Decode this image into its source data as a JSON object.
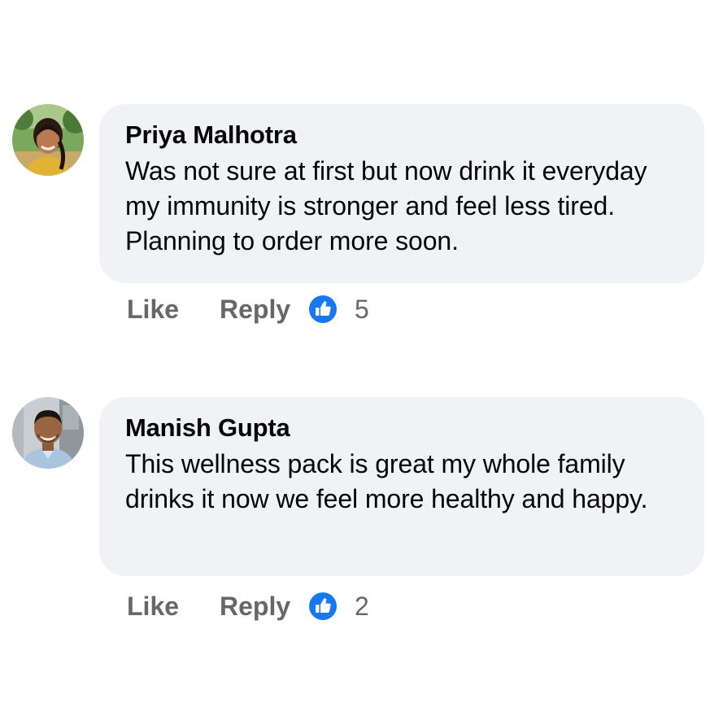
{
  "comments": [
    {
      "author": "Priya Malhotra",
      "text": "Was not sure at first but now drink it everyday my immunity is stronger and feel less tired. Planning to order more soon.",
      "like_label": "Like",
      "reply_label": "Reply",
      "reaction_icon": "like-thumb-icon",
      "reaction_count": "5"
    },
    {
      "author": "Manish Gupta",
      "text": "This wellness pack is great my whole family drinks it now we feel more healthy and happy.",
      "like_label": "Like",
      "reply_label": "Reply",
      "reaction_icon": "like-thumb-icon",
      "reaction_count": "2"
    }
  ],
  "colors": {
    "bubble_background": "#f0f2f5",
    "action_text": "#65676b",
    "like_blue": "#1877f2"
  }
}
